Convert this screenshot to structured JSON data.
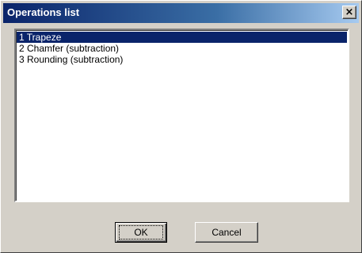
{
  "dialog": {
    "title": "Operations list",
    "close_icon": "close-x-icon",
    "close_glyph": "×"
  },
  "operations": {
    "items": [
      {
        "label": "1 Trapeze",
        "selected": true
      },
      {
        "label": "2 Chamfer (subtraction)",
        "selected": false
      },
      {
        "label": "3 Rounding (subtraction)",
        "selected": false
      }
    ]
  },
  "buttons": {
    "ok_label": "OK",
    "cancel_label": "Cancel"
  },
  "colors": {
    "title_gradient_start": "#0a246a",
    "title_gradient_end": "#a6caf0",
    "selection_bg": "#0a246a",
    "dialog_bg": "#d4d0c8"
  }
}
